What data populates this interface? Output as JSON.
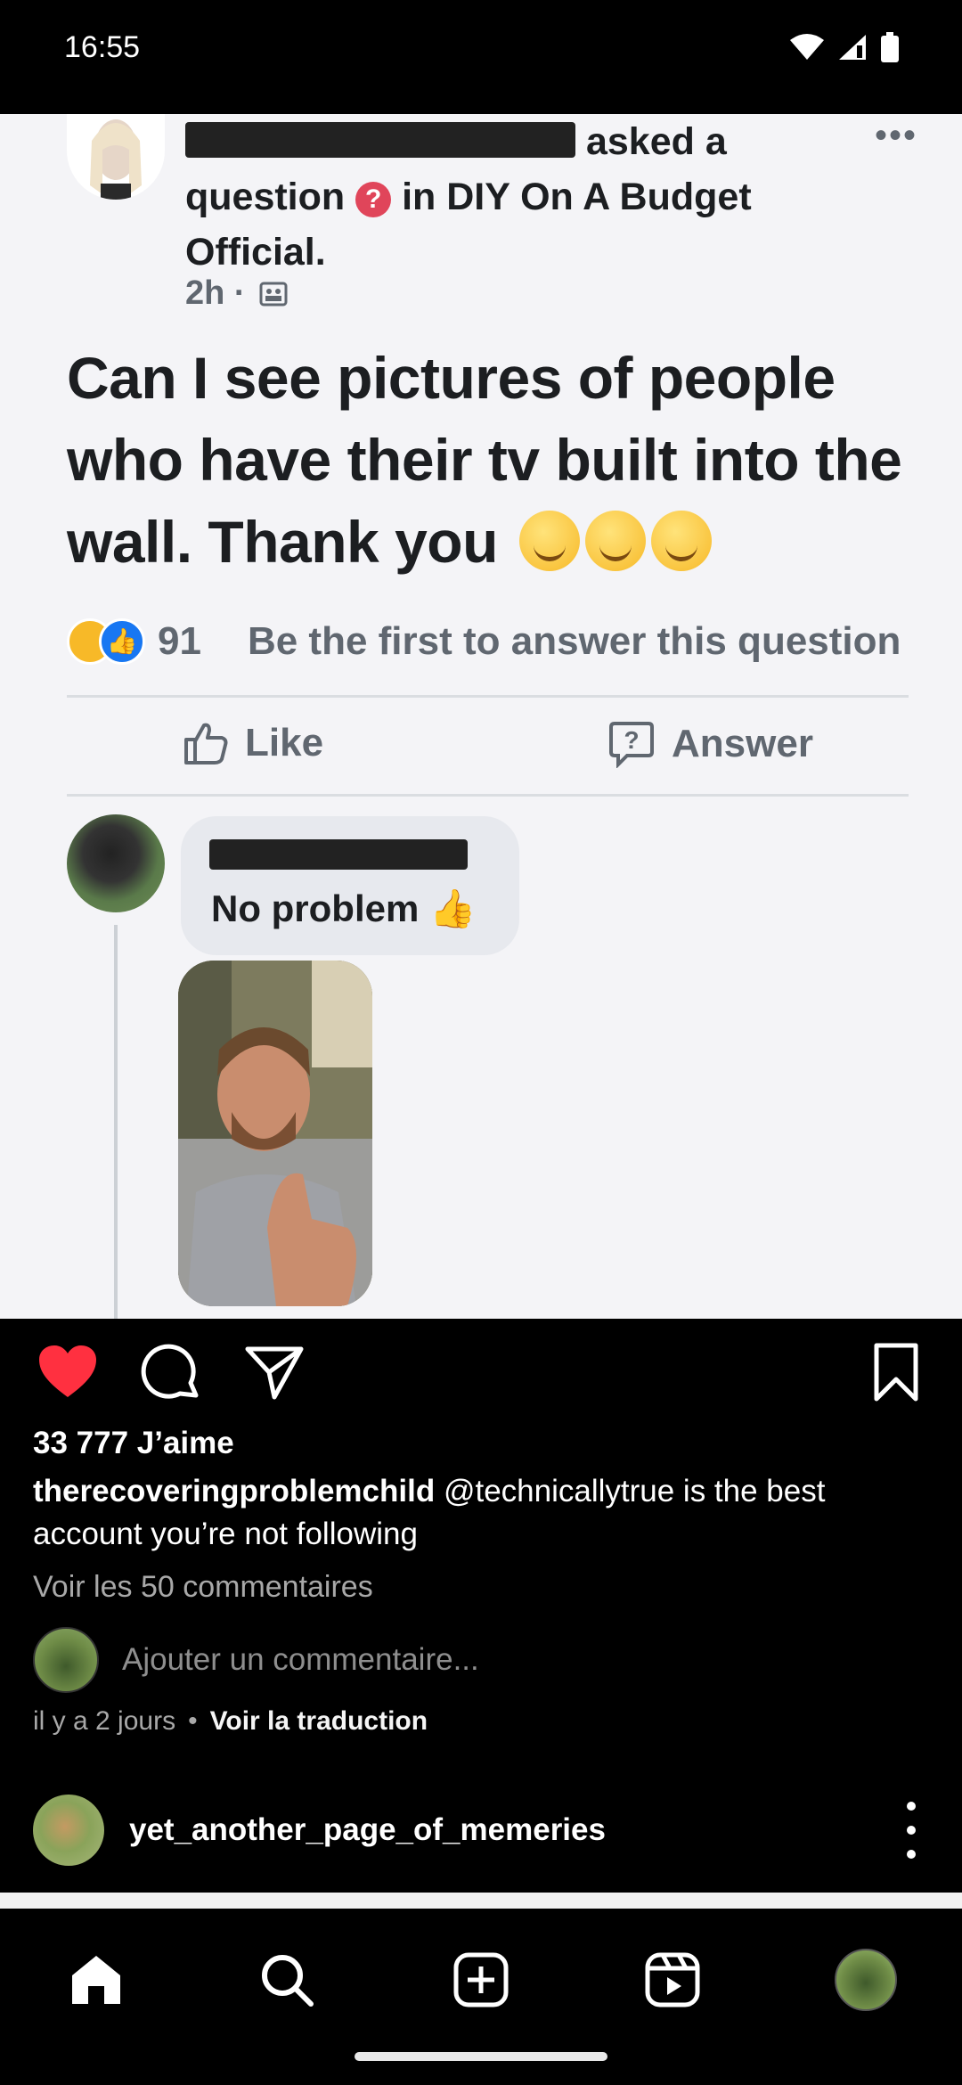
{
  "status_bar": {
    "time": "16:55",
    "icons": [
      "wifi-icon",
      "signal-icon",
      "battery-icon"
    ]
  },
  "post_image": {
    "header_asked": "asked a",
    "header_question": "question",
    "header_in": "in DIY On A Budget",
    "header_group": "Official.",
    "time": "2h ·",
    "question": "Can I see pictures of people who have their tv built into the wall. Thank you",
    "reaction_count": "91",
    "first_answer": "Be the first to answer this question",
    "like_label": "Like",
    "answer_label": "Answer",
    "comment_text": "No problem"
  },
  "post": {
    "likes": "33 777 J’aime",
    "caption_user": "therecoveringproblemchild",
    "caption_text": "@technicallytrue is the best account you’re not following",
    "view_comments": "Voir les 50 commentaires",
    "add_comment_placeholder": "Ajouter un commentaire...",
    "time_ago": "il y a 2 jours",
    "translate": "Voir la traduction"
  },
  "next_post": {
    "username": "yet_another_page_of_memeries"
  },
  "bottom_nav": {
    "items": [
      "home-icon",
      "search-icon",
      "create-icon",
      "reels-icon",
      "profile-avatar"
    ]
  },
  "colors": {
    "like_red": "#ff3040",
    "background": "#000000",
    "muted_text": "#a8a8a8"
  }
}
